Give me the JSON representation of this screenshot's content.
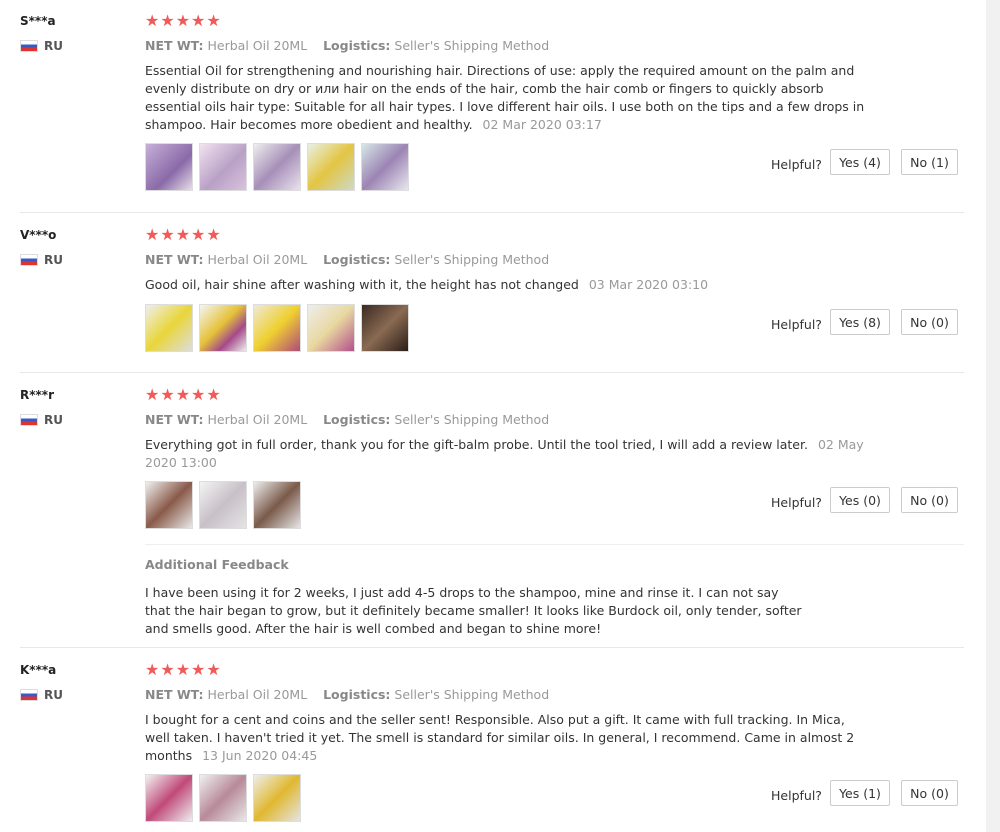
{
  "reviews": [
    {
      "name": "S***a",
      "country": "RU",
      "stars": "★★★★★",
      "net_label": "NET WT:",
      "net_value": "Herbal Oil 20ML",
      "log_label": "Logistics:",
      "log_value": "Seller's Shipping Method",
      "text": "Essential Oil for strengthening and nourishing hair. Directions of use: apply the required amount on the palm and evenly distribute on dry or или hair on the ends of the hair, comb the hair comb or fingers to quickly absorb essential oils hair type: Suitable for all hair types. I love different hair oils. I use both on the tips and a few drops in shampoo. Hair becomes more obedient and healthy.",
      "date": "02 Mar 2020 03:17",
      "helpful_label": "Helpful?",
      "yes": "Yes (4)",
      "no": "No (1)"
    },
    {
      "name": "V***o",
      "country": "RU",
      "stars": "★★★★★",
      "net_label": "NET WT:",
      "net_value": "Herbal Oil 20ML",
      "log_label": "Logistics:",
      "log_value": "Seller's Shipping Method",
      "text": "Good oil, hair shine after washing with it, the height has not changed",
      "date": "03 Mar 2020 03:10",
      "helpful_label": "Helpful?",
      "yes": "Yes (8)",
      "no": "No (0)"
    },
    {
      "name": "R***r",
      "country": "RU",
      "stars": "★★★★★",
      "net_label": "NET WT:",
      "net_value": "Herbal Oil 20ML",
      "log_label": "Logistics:",
      "log_value": "Seller's Shipping Method",
      "text": "Everything got in full order, thank you for the gift-balm probe. Until the tool tried, I will add a review later.",
      "date": "02 May 2020 13:00",
      "helpful_label": "Helpful?",
      "yes": "Yes (0)",
      "no": "No (0)",
      "additional_title": "Additional Feedback",
      "additional_text": "I have been using it for 2 weeks, I just add 4-5 drops to the shampoo, mine and rinse it. I can not say that the hair began to grow, but it definitely became smaller! It looks like Burdock oil, only tender, softer and smells good. After the hair is well combed and began to shine more!"
    },
    {
      "name": "K***a",
      "country": "RU",
      "stars": "★★★★★",
      "net_label": "NET WT:",
      "net_value": "Herbal Oil 20ML",
      "log_label": "Logistics:",
      "log_value": "Seller's Shipping Method",
      "text": "I bought for a cent and coins and the seller sent! Responsible. Also put a gift. It came with full tracking. In Mica, well taken. I haven't tried it yet. The smell is standard for similar oils. In general, I recommend. Came in almost 2 months",
      "date": "13 Jun 2020 04:45",
      "helpful_label": "Helpful?",
      "yes": "Yes (1)",
      "no": "No (0)"
    }
  ],
  "colors": {
    "star": "#f05a5a",
    "muted": "#999999"
  }
}
